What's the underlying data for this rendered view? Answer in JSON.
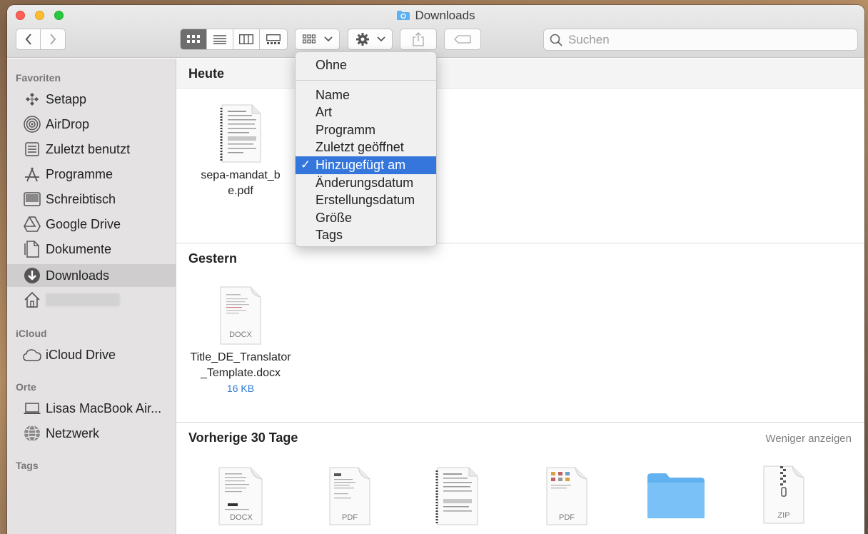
{
  "window": {
    "title": "Downloads"
  },
  "toolbar": {
    "back_label": "back",
    "forward_label": "forward",
    "search_placeholder": "Suchen"
  },
  "sidebar": {
    "favorites_header": "Favoriten",
    "favorites": [
      {
        "label": "Setapp",
        "icon": "setapp-icon"
      },
      {
        "label": "AirDrop",
        "icon": "airdrop-icon"
      },
      {
        "label": "Zuletzt benutzt",
        "icon": "recents-icon"
      },
      {
        "label": "Programme",
        "icon": "applications-icon"
      },
      {
        "label": "Schreibtisch",
        "icon": "desktop-icon"
      },
      {
        "label": "Google Drive",
        "icon": "google-drive-icon"
      },
      {
        "label": "Dokumente",
        "icon": "documents-icon"
      },
      {
        "label": "Downloads",
        "icon": "downloads-icon",
        "selected": true
      },
      {
        "label": "",
        "icon": "home-icon"
      }
    ],
    "icloud_header": "iCloud",
    "icloud": [
      {
        "label": "iCloud Drive",
        "icon": "cloud-icon"
      }
    ],
    "locations_header": "Orte",
    "locations": [
      {
        "label": "Lisas MacBook Air...",
        "icon": "laptop-icon"
      },
      {
        "label": "Netzwerk",
        "icon": "network-icon"
      }
    ],
    "tags_header": "Tags"
  },
  "main": {
    "sections": [
      {
        "title": "Heute",
        "files": [
          {
            "name": "sepa-mandat_be.pdf",
            "type": "pdf"
          }
        ]
      },
      {
        "title": "Gestern",
        "files": [
          {
            "name": "Title_DE_Translator_Template.docx",
            "ext": "DOCX",
            "size": "16 KB"
          }
        ]
      },
      {
        "title": "Vorherige 30 Tage",
        "action": "Weniger anzeigen",
        "files": [
          {
            "ext": "DOCX"
          },
          {
            "ext": "PDF"
          },
          {
            "ext": ""
          },
          {
            "ext": "PDF"
          },
          {
            "ext": "folder"
          },
          {
            "ext": "ZIP"
          }
        ]
      }
    ]
  },
  "sort_menu": {
    "none": "Ohne",
    "items": [
      "Name",
      "Art",
      "Programm",
      "Zuletzt geöffnet",
      "Hinzugefügt am",
      "Änderungsdatum",
      "Erstellungsdatum",
      "Größe",
      "Tags"
    ],
    "selected": "Hinzugefügt am",
    "check": "✓"
  },
  "colors": {
    "accent": "#3476dc",
    "folder": "#6cb7f3",
    "size_link": "#2f7ad8"
  }
}
